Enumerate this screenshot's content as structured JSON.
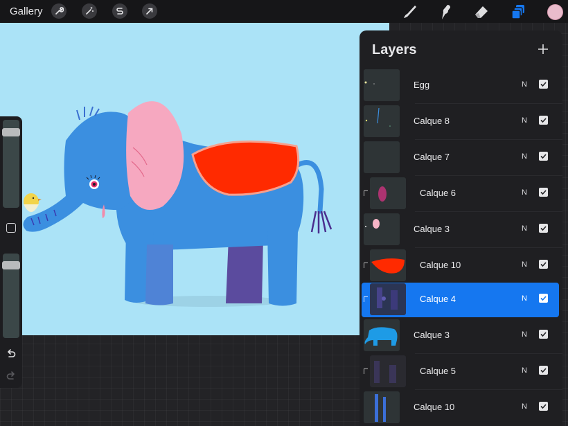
{
  "topbar": {
    "gallery_label": "Gallery",
    "left_tools": [
      "wrench-icon",
      "magic-wand-icon",
      "selection-s-icon",
      "transform-arrow-icon"
    ],
    "right_tools": [
      "brush-icon",
      "smudge-icon",
      "eraser-icon",
      "layers-icon"
    ],
    "color_swatch": "#eabccc",
    "layers_icon_color": "#1577f0"
  },
  "canvas": {
    "background": "#abe3f7",
    "artwork": "elephant-illustration"
  },
  "sidebar": {
    "size_slider_value": 0.06,
    "opacity_slider_value": 0.06
  },
  "layers": {
    "title": "Layers",
    "add_icon": "plus-icon",
    "items": [
      {
        "name": "Egg",
        "blend": "N",
        "visible": true,
        "clipped": false,
        "selected": false
      },
      {
        "name": "Calque 8",
        "blend": "N",
        "visible": true,
        "clipped": false,
        "selected": false
      },
      {
        "name": "Calque 7",
        "blend": "N",
        "visible": true,
        "clipped": false,
        "selected": false
      },
      {
        "name": "Calque 6",
        "blend": "N",
        "visible": true,
        "clipped": true,
        "selected": false
      },
      {
        "name": "Calque 3",
        "blend": "N",
        "visible": true,
        "clipped": false,
        "selected": false
      },
      {
        "name": "Calque 10",
        "blend": "N",
        "visible": true,
        "clipped": true,
        "selected": false
      },
      {
        "name": "Calque 4",
        "blend": "N",
        "visible": true,
        "clipped": true,
        "selected": true
      },
      {
        "name": "Calque 3",
        "blend": "N",
        "visible": true,
        "clipped": false,
        "selected": false
      },
      {
        "name": "Calque 5",
        "blend": "N",
        "visible": true,
        "clipped": true,
        "selected": false
      },
      {
        "name": "Calque 10",
        "blend": "N",
        "visible": true,
        "clipped": false,
        "selected": false
      }
    ],
    "selected_color": "#1577f0"
  }
}
